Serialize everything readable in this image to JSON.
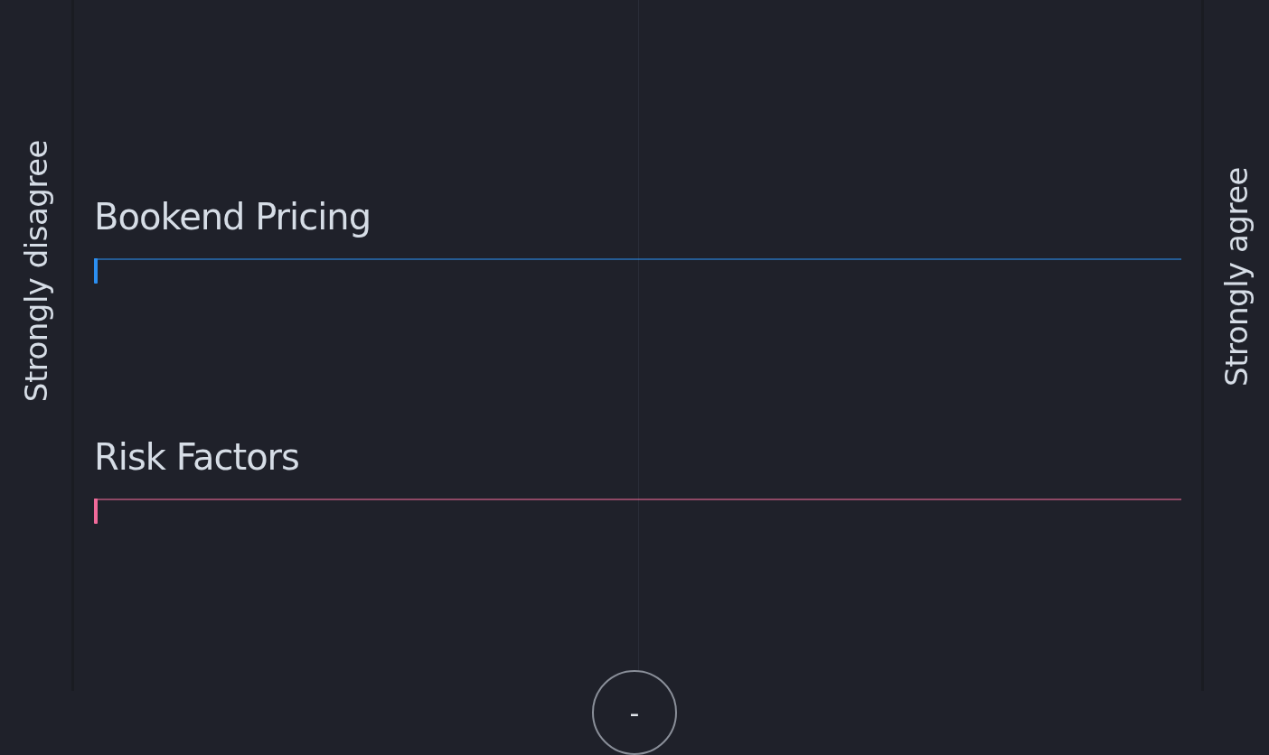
{
  "scale": {
    "left_label": "Strongly disagree",
    "right_label": "Strongly agree"
  },
  "statements": [
    {
      "title": "Bookend Pricing",
      "level": 0,
      "color": "#2b8ef0"
    },
    {
      "title": "Risk Factors",
      "level": 0,
      "color": "#f06a9a"
    }
  ],
  "center_button": {
    "label": "-"
  }
}
